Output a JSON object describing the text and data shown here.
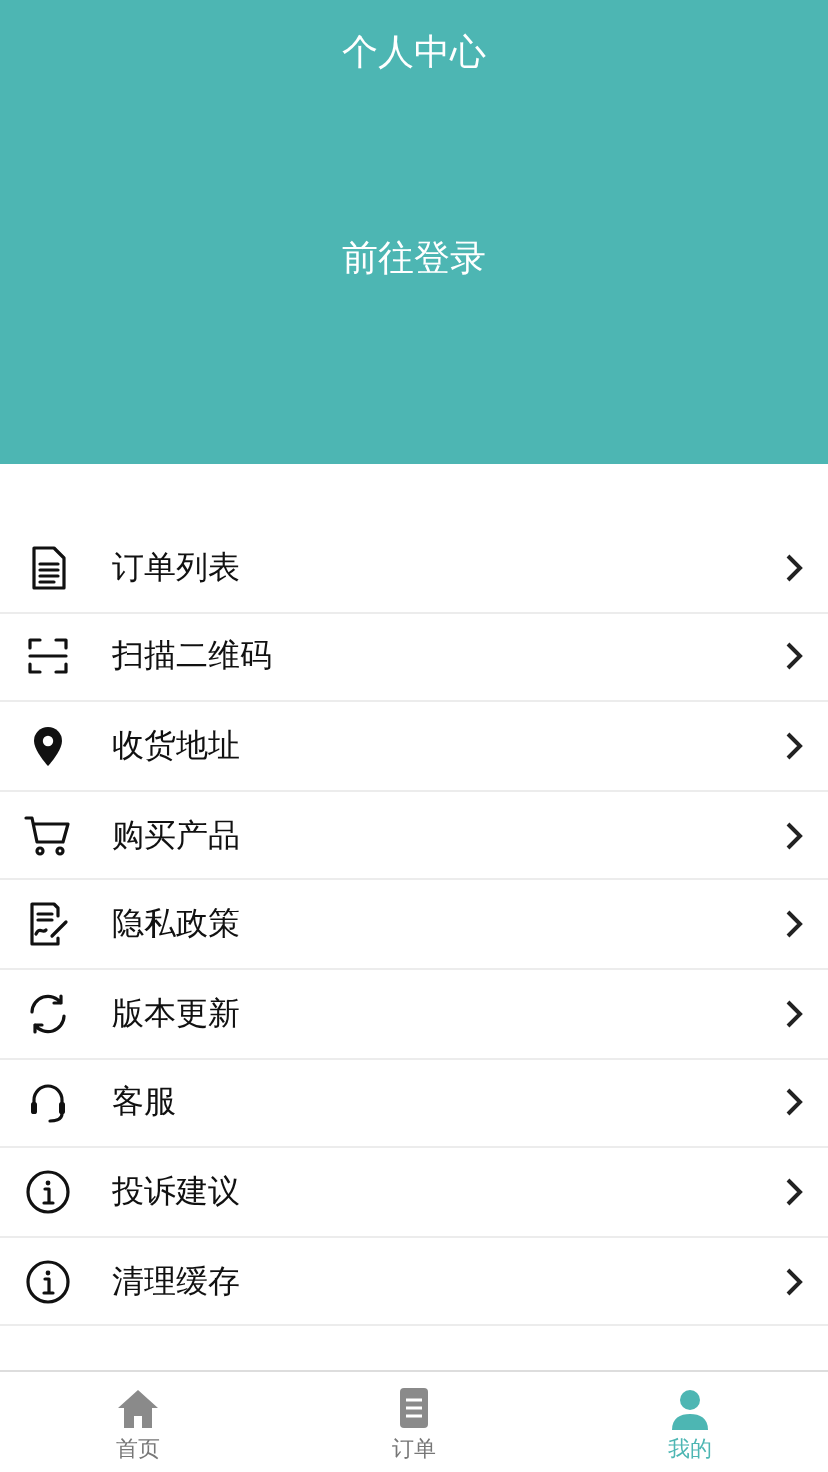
{
  "header": {
    "title": "个人中心",
    "login_link": "前往登录"
  },
  "menu": [
    {
      "label": "订单列表"
    },
    {
      "label": "扫描二维码"
    },
    {
      "label": "收货地址"
    },
    {
      "label": "购买产品"
    },
    {
      "label": "隐私政策"
    },
    {
      "label": "版本更新"
    },
    {
      "label": "客服"
    },
    {
      "label": "投诉建议"
    },
    {
      "label": "清理缓存"
    }
  ],
  "tab_bar": [
    {
      "label": "首页",
      "selected": false
    },
    {
      "label": "订单",
      "selected": false
    },
    {
      "label": "我的",
      "selected": true
    }
  ]
}
